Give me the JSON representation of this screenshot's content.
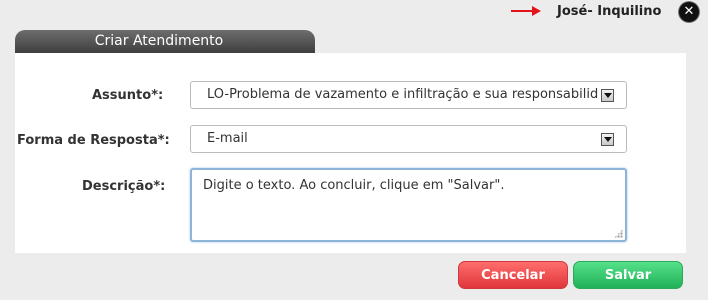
{
  "user": {
    "name": "José- Inquilino",
    "close_symbol": "✕"
  },
  "panel": {
    "title": "Criar Atendimento"
  },
  "form": {
    "subject_label": "Assunto*:",
    "subject_value": "LO-Problema de vazamento e infiltração e sua responsabilidade",
    "response_label": "Forma de Resposta*:",
    "response_value": "E-mail",
    "description_label": "Descrição*:",
    "description_value": "Digite o texto. Ao concluir, clique em \"Salvar\"."
  },
  "actions": {
    "cancel_label": "Cancelar",
    "save_label": "Salvar"
  },
  "colors": {
    "arrow": "#e2141a",
    "cancel_button": "#e0363a",
    "save_button": "#20b157",
    "panel_header": "#4a4a4a"
  }
}
